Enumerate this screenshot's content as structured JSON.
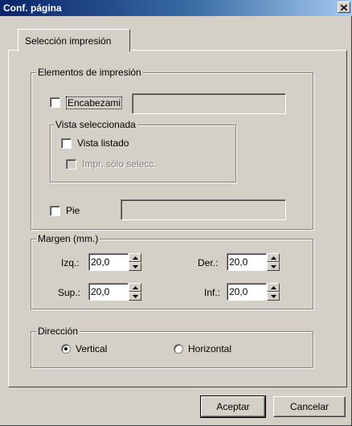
{
  "window": {
    "title": "Conf. página"
  },
  "tabs": [
    {
      "label": "Selección impresión"
    }
  ],
  "print_elements": {
    "group_label": "Elementos de impresión",
    "header": {
      "label": "Encabezami",
      "checked": false,
      "value": ""
    },
    "selected_view": {
      "group_label": "Vista seleccionada",
      "list_view": {
        "label": "Vista listado",
        "checked": false
      },
      "print_selected_only": {
        "label": "Impr. sólo selecc.",
        "checked": false,
        "enabled": false
      }
    },
    "footer": {
      "label": "Pie",
      "checked": false,
      "value": ""
    }
  },
  "margins": {
    "group_label": "Margen (mm.)",
    "left": {
      "label": "Izq.:",
      "value": "20,0"
    },
    "right": {
      "label": "Der.:",
      "value": "20,0"
    },
    "top": {
      "label": "Sup.:",
      "value": "20,0"
    },
    "bottom": {
      "label": "Inf.:",
      "value": "20,0"
    }
  },
  "direction": {
    "group_label": "Dirección",
    "vertical": {
      "label": "Vertical",
      "selected": true
    },
    "horizontal": {
      "label": "Horizontal",
      "selected": false
    }
  },
  "buttons": {
    "accept": "Aceptar",
    "cancel": "Cancelar"
  },
  "colors": {
    "dialog": "#d4d0c8",
    "titlebar_start": "#0a246a",
    "titlebar_end": "#a6caf0"
  }
}
